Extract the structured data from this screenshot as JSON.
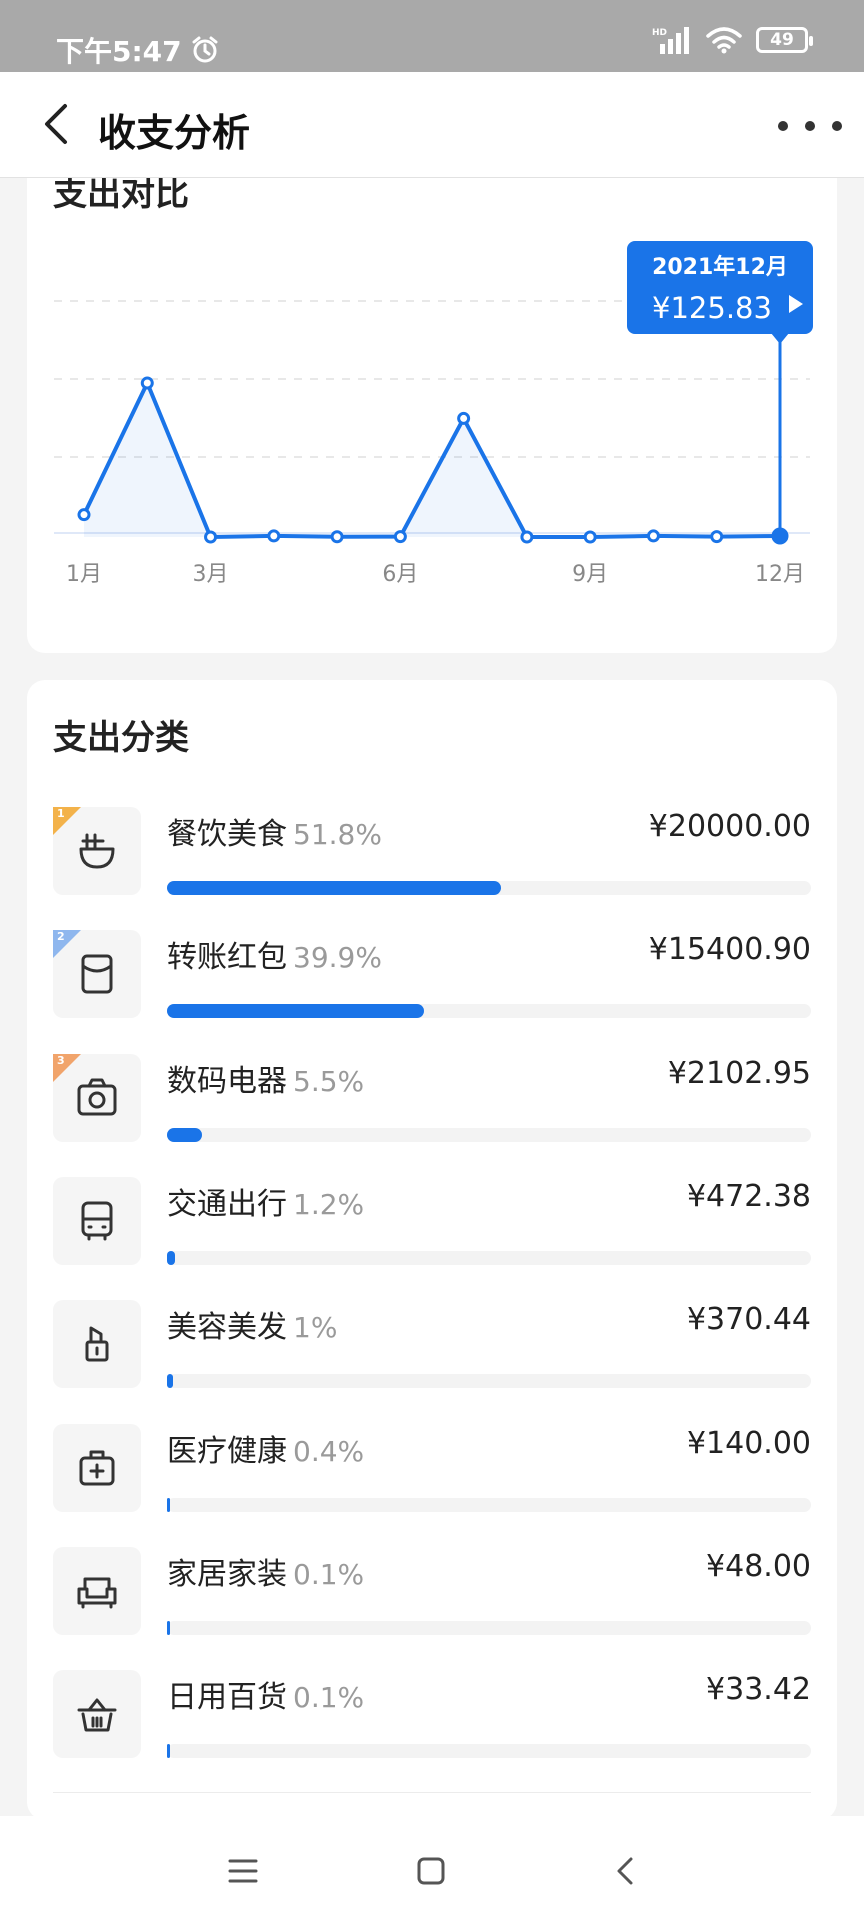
{
  "status_bar": {
    "time": "下午5:47",
    "network": "HD",
    "battery": "49"
  },
  "header": {
    "title": "收支分析"
  },
  "expense_comparison": {
    "title": "支出对比",
    "tooltip": {
      "month": "2021年12月",
      "amount": "¥125.83"
    },
    "chart_data": {
      "type": "line",
      "title": "支出对比",
      "x": [
        1,
        2,
        3,
        4,
        5,
        6,
        7,
        8,
        9,
        10,
        11,
        12
      ],
      "x_tick_labels": [
        "1月",
        "3月",
        "6月",
        "9月",
        "12月"
      ],
      "x_tick_positions": [
        1,
        3,
        6,
        9,
        12
      ],
      "values": [
        2900,
        20000,
        0,
        140,
        33,
        48,
        15400.9,
        0,
        0,
        140,
        48,
        125.83
      ],
      "ylim": [
        0,
        20000
      ],
      "grid": true,
      "selected_index": 11
    }
  },
  "expense_categories": {
    "title": "支出分类",
    "items": [
      {
        "rank": "1",
        "icon": "noodle-bowl-icon",
        "name": "餐饮美食",
        "percent": "51.8%",
        "share": 0.518,
        "amount": "¥20000.00"
      },
      {
        "rank": "2",
        "icon": "red-envelope-icon",
        "name": "转账红包",
        "percent": "39.9%",
        "share": 0.399,
        "amount": "¥15400.90"
      },
      {
        "rank": "3",
        "icon": "camera-icon",
        "name": "数码电器",
        "percent": "5.5%",
        "share": 0.055,
        "amount": "¥2102.95"
      },
      {
        "rank": "",
        "icon": "bus-icon",
        "name": "交通出行",
        "percent": "1.2%",
        "share": 0.012,
        "amount": "¥472.38"
      },
      {
        "rank": "",
        "icon": "lipstick-icon",
        "name": "美容美发",
        "percent": "1%",
        "share": 0.01,
        "amount": "¥370.44"
      },
      {
        "rank": "",
        "icon": "medical-kit-icon",
        "name": "医疗健康",
        "percent": "0.4%",
        "share": 0.004,
        "amount": "¥140.00"
      },
      {
        "rank": "",
        "icon": "sofa-icon",
        "name": "家居家装",
        "percent": "0.1%",
        "share": 0.001,
        "amount": "¥48.00"
      },
      {
        "rank": "",
        "icon": "shopping-basket-icon",
        "name": "日用百货",
        "percent": "0.1%",
        "share": 0.001,
        "amount": "¥33.42"
      }
    ]
  },
  "colors": {
    "accent": "#1a74e8",
    "rank_gold": "#f3b24a",
    "rank_blue": "#8fb7ee",
    "rank_orange": "#f1a46b"
  }
}
